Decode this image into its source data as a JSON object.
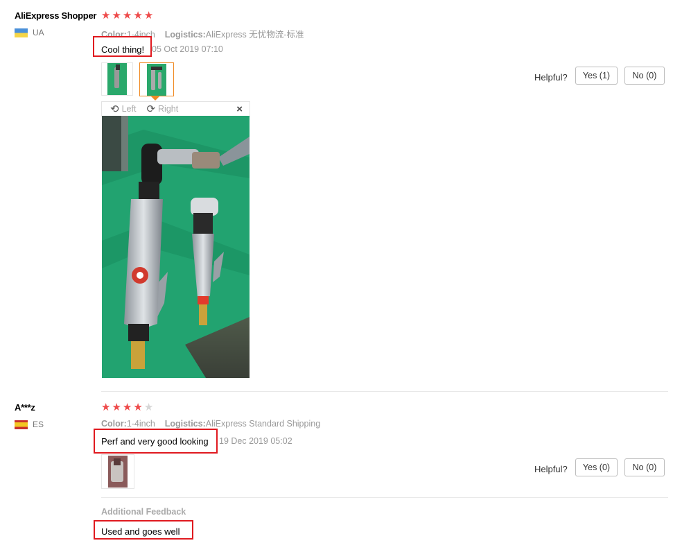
{
  "reviews": [
    {
      "username": "AliExpress Shopper",
      "country": "UA",
      "rating": 5,
      "color_label": "Color:",
      "color_value": "1-4inch",
      "logistics_label": "Logistics:",
      "logistics_value": "AliExpress 无忧物流-标准",
      "feedback": "Cool thing!",
      "date": "05 Oct 2019 07:10",
      "helpful_label": "Helpful?",
      "yes_label": "Yes (1)",
      "no_label": "No (0)",
      "viewer": {
        "rotate_left": "Left",
        "rotate_right": "Right",
        "close": "×"
      }
    },
    {
      "username": "A***z",
      "country": "ES",
      "rating": 4,
      "color_label": "Color:",
      "color_value": "1-4inch",
      "logistics_label": "Logistics:",
      "logistics_value": "AliExpress Standard Shipping",
      "feedback": "Perf and very good looking",
      "date": "19 Dec 2019 05:02",
      "helpful_label": "Helpful?",
      "yes_label": "Yes (0)",
      "no_label": "No (0)",
      "additional_feedback_label": "Additional Feedback",
      "additional_feedback": "Used and goes well"
    }
  ],
  "colors": {
    "star": "#ee4a4a",
    "highlight_box": "#e0191f",
    "selected_thumb": "#f08a24"
  }
}
